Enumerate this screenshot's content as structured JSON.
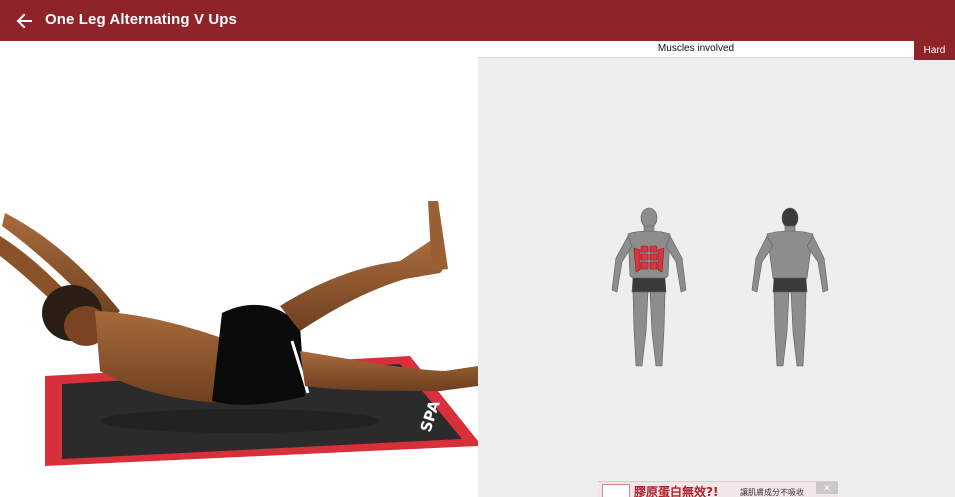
{
  "appbar": {
    "title": "One Leg Alternating V Ups",
    "back_icon": "arrow-left-icon",
    "color": "#8e242a"
  },
  "muscles": {
    "header": "Muscles involved",
    "difficulty": "Hard",
    "highlight_color": "#d9363e"
  },
  "exercise": {
    "mat_brand": "SPA"
  },
  "ad": {
    "headline": "膠原蛋白無效?!",
    "subtext": "讓肌膚成分不吸收",
    "close_label": "✕"
  }
}
